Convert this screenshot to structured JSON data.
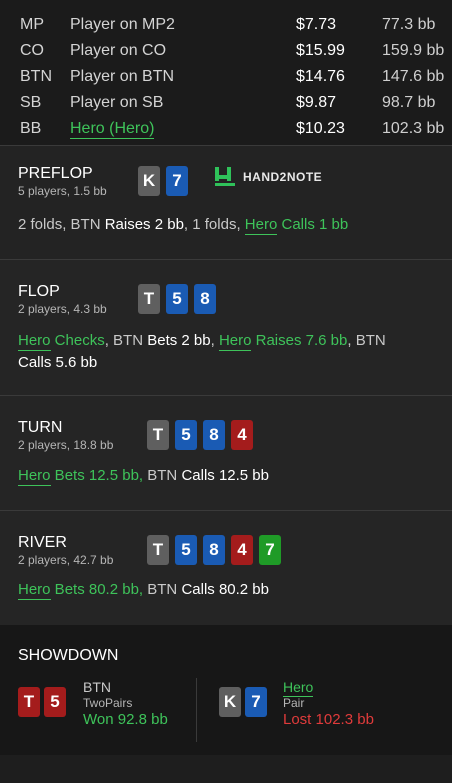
{
  "players": [
    {
      "pos": "MP",
      "name": "Player on MP2",
      "dollars": "$7.73",
      "bb": "77.3 bb",
      "is_hero": false
    },
    {
      "pos": "CO",
      "name": "Player on CO",
      "dollars": "$15.99",
      "bb": "159.9 bb",
      "is_hero": false
    },
    {
      "pos": "BTN",
      "name": "Player on BTN",
      "dollars": "$14.76",
      "bb": "147.6 bb",
      "is_hero": false
    },
    {
      "pos": "SB",
      "name": "Player on SB",
      "dollars": "$9.87",
      "bb": "98.7 bb",
      "is_hero": false
    },
    {
      "pos": "BB",
      "name": "Hero (Hero)",
      "dollars": "$10.23",
      "bb": "102.3 bb",
      "is_hero": true
    }
  ],
  "preflop": {
    "title": "PREFLOP",
    "sub": "5 players, 1.5 bb",
    "cards": [
      {
        "rank": "K",
        "suit_color": "gray"
      },
      {
        "rank": "7",
        "suit_color": "blue"
      }
    ],
    "logo_text": "HAND2NOTE",
    "action": {
      "p1": "2 folds, BTN ",
      "p2": "Raises 2 bb",
      "p3": ", 1 folds, ",
      "hero": "Hero",
      "hero_act": " Calls 1 bb"
    }
  },
  "flop": {
    "title": "FLOP",
    "sub": "2 players, 4.3 bb",
    "cards": [
      {
        "rank": "T",
        "suit_color": "gray"
      },
      {
        "rank": "5",
        "suit_color": "blue"
      },
      {
        "rank": "8",
        "suit_color": "blue"
      }
    ],
    "action": {
      "hero1": "Hero",
      "hero1_act": " Checks",
      "p1": ", BTN ",
      "p2": "Bets 2 bb",
      "p3": ", ",
      "hero2": "Hero",
      "hero2_act": " Raises 7.6 bb",
      "p4": ", BTN",
      "p5": "Calls 5.6 bb"
    }
  },
  "turn": {
    "title": "TURN",
    "sub": "2 players, 18.8 bb",
    "cards": [
      {
        "rank": "T",
        "suit_color": "gray"
      },
      {
        "rank": "5",
        "suit_color": "blue"
      },
      {
        "rank": "8",
        "suit_color": "blue"
      },
      {
        "rank": "4",
        "suit_color": "red"
      }
    ],
    "action": {
      "hero": "Hero",
      "hero_act": " Bets 12.5 bb,",
      "p1": " BTN ",
      "p2": "Calls 12.5 bb"
    }
  },
  "river": {
    "title": "RIVER",
    "sub": "2 players, 42.7 bb",
    "cards": [
      {
        "rank": "T",
        "suit_color": "gray"
      },
      {
        "rank": "5",
        "suit_color": "blue"
      },
      {
        "rank": "8",
        "suit_color": "blue"
      },
      {
        "rank": "4",
        "suit_color": "red"
      },
      {
        "rank": "7",
        "suit_color": "green"
      }
    ],
    "action": {
      "hero": "Hero",
      "hero_act": " Bets 80.2 bb,",
      "p1": " BTN ",
      "p2": "Calls 80.2 bb"
    }
  },
  "showdown": {
    "title": "SHOWDOWN",
    "left": {
      "cards": [
        {
          "rank": "T",
          "suit_color": "red"
        },
        {
          "rank": "5",
          "suit_color": "red"
        }
      ],
      "name": "BTN",
      "hand": "TwoPairs",
      "result": "Won 92.8 bb"
    },
    "right": {
      "cards": [
        {
          "rank": "K",
          "suit_color": "gray"
        },
        {
          "rank": "7",
          "suit_color": "blue"
        }
      ],
      "name": "Hero",
      "hand": "Pair",
      "result": "Lost 102.3 bb"
    }
  },
  "colors": {
    "gray": "#5f5f5f",
    "blue": "#1a5bb4",
    "red": "#a41c1c",
    "green": "#1f9b27",
    "hero": "#3ec35a",
    "lost": "#e03b3b"
  }
}
